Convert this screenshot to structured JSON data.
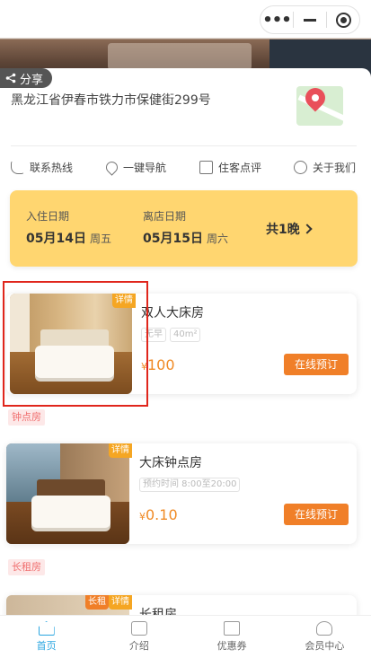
{
  "capsule": {
    "more_icon": "more-dots-icon",
    "minimize_icon": "minimize-icon",
    "close_icon": "target-circle-icon"
  },
  "share": {
    "label": "分享",
    "icon": "share-icon"
  },
  "hotel": {
    "address": "黑龙江省伊春市铁力市保健街299号",
    "map_icon": "map-pin-icon"
  },
  "quick_links": [
    {
      "label": "联系热线",
      "icon": "phone-icon"
    },
    {
      "label": "一键导航",
      "icon": "location-pin-icon"
    },
    {
      "label": "住客点评",
      "icon": "comment-icon"
    },
    {
      "label": "关于我们",
      "icon": "user-icon"
    }
  ],
  "dates": {
    "checkin_label": "入住日期",
    "checkin_date": "05月14日",
    "checkin_weekday": "周五",
    "checkout_label": "离店日期",
    "checkout_date": "05月15日",
    "checkout_weekday": "周六",
    "nights": "共1晚"
  },
  "rooms": [
    {
      "name": "双人大床房",
      "badge": "详情",
      "tags": [
        "无早",
        "40m²"
      ],
      "currency": "¥",
      "price": "100",
      "book": "在线预订"
    },
    {
      "category": "钟点房",
      "name": "大床钟点房",
      "badge": "详情",
      "tags": [
        "预约时间 8:00至20:00"
      ],
      "currency": "¥",
      "price": "0.10",
      "book": "在线预订"
    },
    {
      "category": "长租房",
      "name": "长租房",
      "badge": "详情",
      "badge2": "长租"
    }
  ],
  "tabbar": [
    {
      "label": "首页",
      "icon": "home-icon",
      "active": true
    },
    {
      "label": "介绍",
      "icon": "cube-icon",
      "active": false
    },
    {
      "label": "优惠券",
      "icon": "coupon-icon",
      "active": false
    },
    {
      "label": "会员中心",
      "icon": "member-icon",
      "active": false
    }
  ],
  "colors": {
    "accent": "#29a5e0",
    "orange": "#f07f28",
    "date_card": "#ffd670",
    "highlight": "#e0261c"
  }
}
